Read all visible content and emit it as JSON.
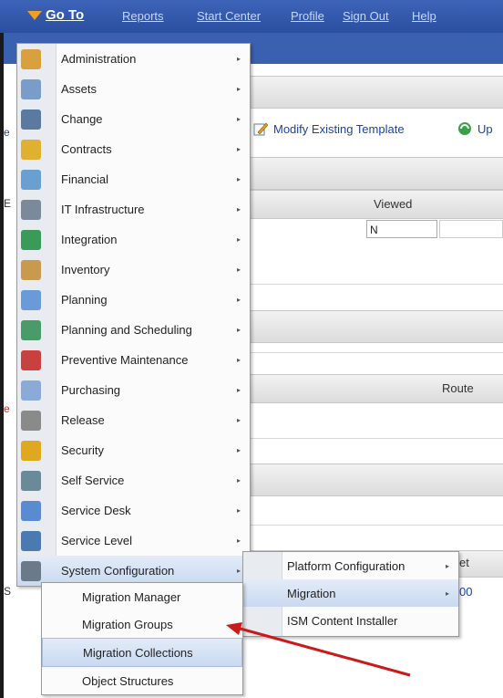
{
  "nav": {
    "goto": "Go To",
    "links": [
      "Reports",
      "Start Center",
      "Profile",
      "Sign Out",
      "Help"
    ]
  },
  "background": {
    "modify_template": "Modify Existing Template",
    "up_partial": "Up",
    "col_viewed": "Viewed",
    "viewed_value": "N",
    "col_route": "Route",
    "partial_et": "et",
    "partial_00": "00",
    "left_partials": [
      "e",
      "E",
      "e",
      "S"
    ]
  },
  "goto_menu": {
    "items": [
      {
        "label": "Administration",
        "icon": "administration-icon",
        "color": "#d9a040"
      },
      {
        "label": "Assets",
        "icon": "assets-icon",
        "color": "#7a9cc8"
      },
      {
        "label": "Change",
        "icon": "change-icon",
        "color": "#5a7aa0"
      },
      {
        "label": "Contracts",
        "icon": "contracts-icon",
        "color": "#e0b030"
      },
      {
        "label": "Financial",
        "icon": "financial-icon",
        "color": "#6aa0d0"
      },
      {
        "label": "IT Infrastructure",
        "icon": "it-infrastructure-icon",
        "color": "#7a8a9a"
      },
      {
        "label": "Integration",
        "icon": "integration-icon",
        "color": "#3a9a5a"
      },
      {
        "label": "Inventory",
        "icon": "inventory-icon",
        "color": "#c89a50"
      },
      {
        "label": "Planning",
        "icon": "planning-icon",
        "color": "#6a9ad8"
      },
      {
        "label": "Planning and Scheduling",
        "icon": "planning-scheduling-icon",
        "color": "#4a9a6a"
      },
      {
        "label": "Preventive Maintenance",
        "icon": "preventive-maintenance-icon",
        "color": "#c84040"
      },
      {
        "label": "Purchasing",
        "icon": "purchasing-icon",
        "color": "#8aaad8"
      },
      {
        "label": "Release",
        "icon": "release-icon",
        "color": "#8a8a8a"
      },
      {
        "label": "Security",
        "icon": "security-icon",
        "color": "#e0a820"
      },
      {
        "label": "Self Service",
        "icon": "self-service-icon",
        "color": "#6a8a9a"
      },
      {
        "label": "Service Desk",
        "icon": "service-desk-icon",
        "color": "#5a8ad0"
      },
      {
        "label": "Service Level",
        "icon": "service-level-icon",
        "color": "#4a7ab0"
      },
      {
        "label": "System Configuration",
        "icon": "system-configuration-icon",
        "color": "#6a7a8a"
      }
    ],
    "arrow": "▸"
  },
  "sysconfig_menu": {
    "items": [
      "Platform Configuration",
      "Migration",
      "ISM Content Installer"
    ]
  },
  "migration_menu": {
    "items": [
      "Migration Manager",
      "Migration Groups",
      "Migration Collections",
      "Object Structures"
    ]
  },
  "colors": {
    "nav_bg": "#2a4fa0",
    "menu_highlight": "#c9d9f0",
    "annotation_arrow": "#cc1a1a"
  }
}
